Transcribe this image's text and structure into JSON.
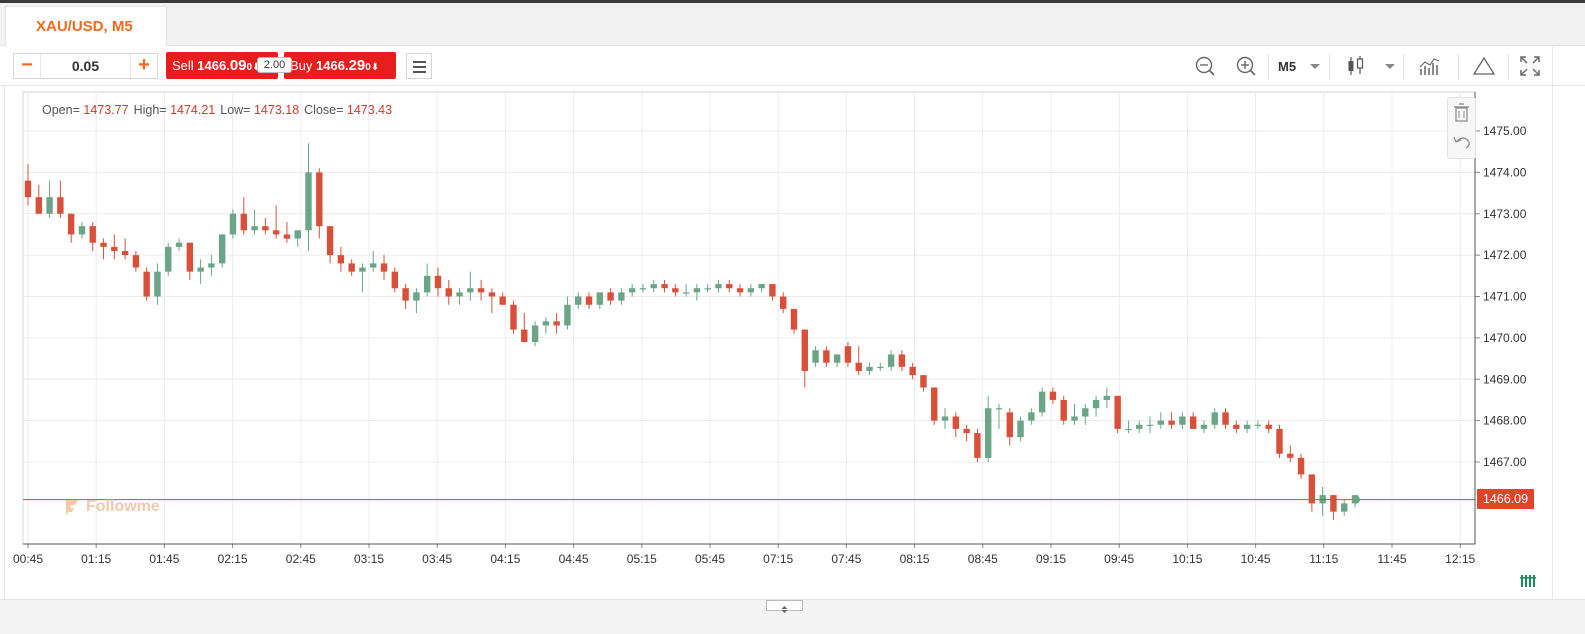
{
  "tab": {
    "title": "XAU/USD, M5"
  },
  "order": {
    "quantity": "0.05",
    "minus_label": "−",
    "plus_label": "+",
    "sell_label": "Sell ",
    "sell_price_main": "1466.",
    "sell_price_big": "09",
    "sell_price_tail": "0",
    "buy_label": "Buy ",
    "buy_price_main": "1466.",
    "buy_price_big": "29",
    "buy_price_tail": "0",
    "lot_badge": "2.00"
  },
  "toolbar": {
    "timeframe": "M5",
    "icons": [
      "zoom-out-icon",
      "zoom-in-icon",
      "candlestick-icon",
      "indicators-icon",
      "drawing-triangle-icon",
      "fullscreen-icon"
    ]
  },
  "ohlc": {
    "open_label": "Open=",
    "open": "1473.77",
    "high_label": "High=",
    "high": "1474.21",
    "low_label": "Low=",
    "low": "1473.18",
    "close_label": "Close=",
    "close": "1473.43"
  },
  "watermark": "Followme",
  "current_price": "1466.09",
  "colors": {
    "up": "#6aa587",
    "down": "#d9503a",
    "accent": "#f26b1d",
    "price_line": "#c0533f"
  },
  "chart_data": {
    "type": "candlestick",
    "y_axis": {
      "ticks": [
        "1475.00",
        "1474.00",
        "1473.00",
        "1472.00",
        "1471.00",
        "1470.00",
        "1469.00",
        "1468.00",
        "1467.00"
      ],
      "range": [
        1465.0,
        1475.8
      ]
    },
    "x_axis": {
      "ticks": [
        "00:45",
        "01:15",
        "01:45",
        "02:15",
        "02:45",
        "03:15",
        "03:45",
        "04:15",
        "04:45",
        "05:15",
        "05:45",
        "07:15",
        "07:45",
        "08:15",
        "08:45",
        "09:15",
        "09:45",
        "10:15",
        "10:45",
        "11:15",
        "11:45",
        "12:15"
      ]
    },
    "candles": [
      [
        1473.8,
        1474.2,
        1473.2,
        1473.4
      ],
      [
        1473.4,
        1473.7,
        1473.0,
        1473.0
      ],
      [
        1473.0,
        1473.8,
        1472.9,
        1473.4
      ],
      [
        1473.4,
        1473.8,
        1472.9,
        1473.0
      ],
      [
        1473.0,
        1473.0,
        1472.3,
        1472.5
      ],
      [
        1472.5,
        1472.8,
        1472.4,
        1472.7
      ],
      [
        1472.7,
        1472.8,
        1472.1,
        1472.3
      ],
      [
        1472.3,
        1472.4,
        1471.9,
        1472.2
      ],
      [
        1472.2,
        1472.5,
        1471.9,
        1472.1
      ],
      [
        1472.1,
        1472.4,
        1471.9,
        1472.0
      ],
      [
        1472.0,
        1472.1,
        1471.6,
        1471.7
      ],
      [
        1471.6,
        1471.7,
        1470.9,
        1471.0
      ],
      [
        1471.0,
        1471.8,
        1470.8,
        1471.6
      ],
      [
        1471.6,
        1472.3,
        1471.5,
        1472.2
      ],
      [
        1472.2,
        1472.4,
        1472.1,
        1472.3
      ],
      [
        1472.3,
        1472.3,
        1471.4,
        1471.6
      ],
      [
        1471.6,
        1471.9,
        1471.3,
        1471.7
      ],
      [
        1471.7,
        1472.0,
        1471.5,
        1471.8
      ],
      [
        1471.8,
        1472.5,
        1471.7,
        1472.5
      ],
      [
        1472.5,
        1473.1,
        1472.4,
        1473.0
      ],
      [
        1473.0,
        1473.4,
        1472.5,
        1472.6
      ],
      [
        1472.6,
        1473.1,
        1472.5,
        1472.7
      ],
      [
        1472.7,
        1472.9,
        1472.5,
        1472.6
      ],
      [
        1472.6,
        1473.2,
        1472.4,
        1472.5
      ],
      [
        1472.5,
        1472.8,
        1472.3,
        1472.4
      ],
      [
        1472.4,
        1472.6,
        1472.2,
        1472.6
      ],
      [
        1472.6,
        1474.7,
        1472.1,
        1474.0
      ],
      [
        1474.0,
        1474.1,
        1472.4,
        1472.7
      ],
      [
        1472.7,
        1472.7,
        1471.8,
        1472.0
      ],
      [
        1472.0,
        1472.2,
        1471.6,
        1471.8
      ],
      [
        1471.8,
        1471.9,
        1471.5,
        1471.6
      ],
      [
        1471.6,
        1471.8,
        1471.1,
        1471.7
      ],
      [
        1471.7,
        1472.1,
        1471.6,
        1471.8
      ],
      [
        1471.8,
        1472.0,
        1471.4,
        1471.6
      ],
      [
        1471.6,
        1471.7,
        1471.1,
        1471.2
      ],
      [
        1471.2,
        1471.3,
        1470.7,
        1470.9
      ],
      [
        1470.9,
        1471.2,
        1470.6,
        1471.1
      ],
      [
        1471.1,
        1471.8,
        1471.0,
        1471.5
      ],
      [
        1471.5,
        1471.7,
        1471.0,
        1471.2
      ],
      [
        1471.2,
        1471.4,
        1470.8,
        1471.0
      ],
      [
        1471.0,
        1471.2,
        1470.8,
        1471.1
      ],
      [
        1471.1,
        1471.6,
        1470.9,
        1471.2
      ],
      [
        1471.2,
        1471.4,
        1470.9,
        1471.1
      ],
      [
        1471.1,
        1471.2,
        1470.6,
        1471.0
      ],
      [
        1471.0,
        1471.1,
        1470.8,
        1470.8
      ],
      [
        1470.8,
        1470.9,
        1470.1,
        1470.2
      ],
      [
        1470.2,
        1470.6,
        1469.9,
        1469.9
      ],
      [
        1469.9,
        1470.4,
        1469.8,
        1470.3
      ],
      [
        1470.3,
        1470.5,
        1470.1,
        1470.4
      ],
      [
        1470.4,
        1470.6,
        1470.1,
        1470.3
      ],
      [
        1470.3,
        1471.0,
        1470.2,
        1470.8
      ],
      [
        1470.8,
        1471.1,
        1470.7,
        1471.0
      ],
      [
        1471.0,
        1471.1,
        1470.7,
        1470.8
      ],
      [
        1470.8,
        1471.1,
        1470.7,
        1471.1
      ],
      [
        1471.1,
        1471.2,
        1470.8,
        1470.9
      ],
      [
        1470.9,
        1471.2,
        1470.8,
        1471.1
      ],
      [
        1471.1,
        1471.3,
        1471.0,
        1471.2
      ],
      [
        1471.2,
        1471.3,
        1471.1,
        1471.2
      ],
      [
        1471.2,
        1471.4,
        1471.1,
        1471.3
      ],
      [
        1471.3,
        1471.4,
        1471.1,
        1471.2
      ],
      [
        1471.2,
        1471.3,
        1471.0,
        1471.1
      ],
      [
        1471.1,
        1471.3,
        1471.0,
        1471.1
      ],
      [
        1471.1,
        1471.3,
        1470.9,
        1471.2
      ],
      [
        1471.2,
        1471.3,
        1471.1,
        1471.2
      ],
      [
        1471.2,
        1471.4,
        1471.1,
        1471.3
      ],
      [
        1471.3,
        1471.4,
        1471.1,
        1471.2
      ],
      [
        1471.2,
        1471.3,
        1471.0,
        1471.1
      ],
      [
        1471.1,
        1471.3,
        1471.0,
        1471.2
      ],
      [
        1471.2,
        1471.3,
        1471.1,
        1471.3
      ],
      [
        1471.3,
        1471.3,
        1470.9,
        1471.0
      ],
      [
        1471.0,
        1471.1,
        1470.6,
        1470.7
      ],
      [
        1470.7,
        1470.7,
        1470.1,
        1470.2
      ],
      [
        1470.2,
        1470.2,
        1468.8,
        1469.2
      ],
      [
        1469.4,
        1469.8,
        1469.3,
        1469.7
      ],
      [
        1469.7,
        1469.8,
        1469.3,
        1469.4
      ],
      [
        1469.4,
        1469.6,
        1469.3,
        1469.6
      ],
      [
        1469.8,
        1469.9,
        1469.3,
        1469.4
      ],
      [
        1469.4,
        1469.8,
        1469.1,
        1469.2
      ],
      [
        1469.2,
        1469.4,
        1469.1,
        1469.3
      ],
      [
        1469.3,
        1469.4,
        1469.2,
        1469.3
      ],
      [
        1469.3,
        1469.7,
        1469.2,
        1469.6
      ],
      [
        1469.6,
        1469.7,
        1469.2,
        1469.3
      ],
      [
        1469.3,
        1469.4,
        1469.0,
        1469.1
      ],
      [
        1469.1,
        1469.1,
        1468.7,
        1468.8
      ],
      [
        1468.8,
        1468.8,
        1467.9,
        1468.0
      ],
      [
        1468.0,
        1468.3,
        1467.8,
        1468.1
      ],
      [
        1468.1,
        1468.2,
        1467.6,
        1467.8
      ],
      [
        1467.8,
        1467.9,
        1467.5,
        1467.7
      ],
      [
        1467.7,
        1467.8,
        1467.0,
        1467.1
      ],
      [
        1467.1,
        1468.6,
        1467.0,
        1468.3
      ],
      [
        1468.3,
        1468.4,
        1467.8,
        1468.3
      ],
      [
        1468.2,
        1468.3,
        1467.4,
        1467.6
      ],
      [
        1467.6,
        1468.1,
        1467.5,
        1468.0
      ],
      [
        1468.0,
        1468.3,
        1467.9,
        1468.2
      ],
      [
        1468.2,
        1468.8,
        1468.1,
        1468.7
      ],
      [
        1468.7,
        1468.8,
        1468.4,
        1468.5
      ],
      [
        1468.5,
        1468.6,
        1467.9,
        1468.0
      ],
      [
        1468.0,
        1468.4,
        1467.9,
        1468.1
      ],
      [
        1468.1,
        1468.4,
        1467.9,
        1468.3
      ],
      [
        1468.3,
        1468.6,
        1468.1,
        1468.5
      ],
      [
        1468.5,
        1468.8,
        1468.3,
        1468.6
      ],
      [
        1468.6,
        1468.6,
        1467.7,
        1467.8
      ],
      [
        1467.8,
        1468.0,
        1467.7,
        1467.8
      ],
      [
        1467.8,
        1468.0,
        1467.7,
        1467.9
      ],
      [
        1467.9,
        1468.1,
        1467.7,
        1467.9
      ],
      [
        1467.9,
        1468.2,
        1467.8,
        1468.0
      ],
      [
        1468.0,
        1468.2,
        1467.8,
        1467.9
      ],
      [
        1467.9,
        1468.2,
        1467.8,
        1468.1
      ],
      [
        1468.1,
        1468.2,
        1467.8,
        1467.8
      ],
      [
        1467.8,
        1468.0,
        1467.7,
        1467.9
      ],
      [
        1467.9,
        1468.3,
        1467.8,
        1468.2
      ],
      [
        1468.2,
        1468.3,
        1467.8,
        1467.9
      ],
      [
        1467.9,
        1468.0,
        1467.7,
        1467.8
      ],
      [
        1467.8,
        1468.0,
        1467.7,
        1467.9
      ],
      [
        1467.9,
        1468.0,
        1467.8,
        1467.9
      ],
      [
        1467.9,
        1468.0,
        1467.7,
        1467.8
      ],
      [
        1467.8,
        1467.9,
        1467.1,
        1467.2
      ],
      [
        1467.2,
        1467.4,
        1467.0,
        1467.1
      ],
      [
        1467.1,
        1467.2,
        1466.6,
        1466.7
      ],
      [
        1466.7,
        1466.7,
        1465.8,
        1466.0
      ],
      [
        1466.0,
        1466.4,
        1465.7,
        1466.2
      ],
      [
        1466.2,
        1466.2,
        1465.6,
        1465.8
      ],
      [
        1465.8,
        1466.1,
        1465.7,
        1466.0
      ],
      [
        1466.0,
        1466.2,
        1465.9,
        1466.2
      ]
    ]
  }
}
